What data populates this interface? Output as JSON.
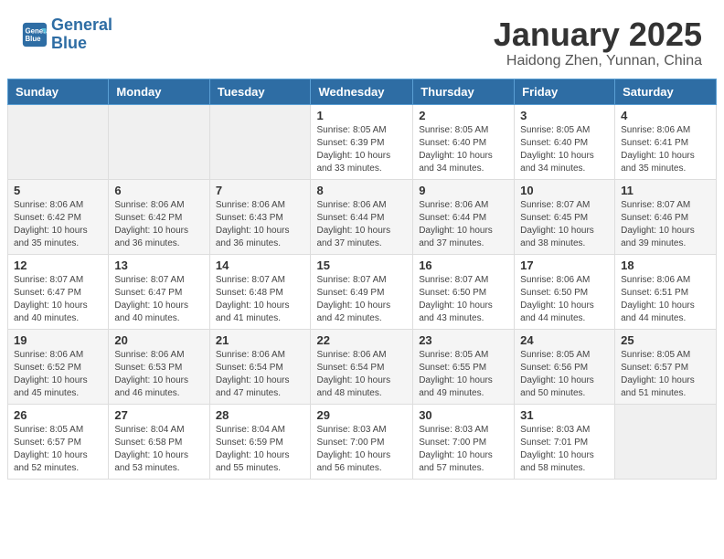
{
  "header": {
    "logo_line1": "General",
    "logo_line2": "Blue",
    "title": "January 2025",
    "subtitle": "Haidong Zhen, Yunnan, China"
  },
  "days_of_week": [
    "Sunday",
    "Monday",
    "Tuesday",
    "Wednesday",
    "Thursday",
    "Friday",
    "Saturday"
  ],
  "weeks": [
    [
      {
        "day": "",
        "info": ""
      },
      {
        "day": "",
        "info": ""
      },
      {
        "day": "",
        "info": ""
      },
      {
        "day": "1",
        "info": "Sunrise: 8:05 AM\nSunset: 6:39 PM\nDaylight: 10 hours\nand 33 minutes."
      },
      {
        "day": "2",
        "info": "Sunrise: 8:05 AM\nSunset: 6:40 PM\nDaylight: 10 hours\nand 34 minutes."
      },
      {
        "day": "3",
        "info": "Sunrise: 8:05 AM\nSunset: 6:40 PM\nDaylight: 10 hours\nand 34 minutes."
      },
      {
        "day": "4",
        "info": "Sunrise: 8:06 AM\nSunset: 6:41 PM\nDaylight: 10 hours\nand 35 minutes."
      }
    ],
    [
      {
        "day": "5",
        "info": "Sunrise: 8:06 AM\nSunset: 6:42 PM\nDaylight: 10 hours\nand 35 minutes."
      },
      {
        "day": "6",
        "info": "Sunrise: 8:06 AM\nSunset: 6:42 PM\nDaylight: 10 hours\nand 36 minutes."
      },
      {
        "day": "7",
        "info": "Sunrise: 8:06 AM\nSunset: 6:43 PM\nDaylight: 10 hours\nand 36 minutes."
      },
      {
        "day": "8",
        "info": "Sunrise: 8:06 AM\nSunset: 6:44 PM\nDaylight: 10 hours\nand 37 minutes."
      },
      {
        "day": "9",
        "info": "Sunrise: 8:06 AM\nSunset: 6:44 PM\nDaylight: 10 hours\nand 37 minutes."
      },
      {
        "day": "10",
        "info": "Sunrise: 8:07 AM\nSunset: 6:45 PM\nDaylight: 10 hours\nand 38 minutes."
      },
      {
        "day": "11",
        "info": "Sunrise: 8:07 AM\nSunset: 6:46 PM\nDaylight: 10 hours\nand 39 minutes."
      }
    ],
    [
      {
        "day": "12",
        "info": "Sunrise: 8:07 AM\nSunset: 6:47 PM\nDaylight: 10 hours\nand 40 minutes."
      },
      {
        "day": "13",
        "info": "Sunrise: 8:07 AM\nSunset: 6:47 PM\nDaylight: 10 hours\nand 40 minutes."
      },
      {
        "day": "14",
        "info": "Sunrise: 8:07 AM\nSunset: 6:48 PM\nDaylight: 10 hours\nand 41 minutes."
      },
      {
        "day": "15",
        "info": "Sunrise: 8:07 AM\nSunset: 6:49 PM\nDaylight: 10 hours\nand 42 minutes."
      },
      {
        "day": "16",
        "info": "Sunrise: 8:07 AM\nSunset: 6:50 PM\nDaylight: 10 hours\nand 43 minutes."
      },
      {
        "day": "17",
        "info": "Sunrise: 8:06 AM\nSunset: 6:50 PM\nDaylight: 10 hours\nand 44 minutes."
      },
      {
        "day": "18",
        "info": "Sunrise: 8:06 AM\nSunset: 6:51 PM\nDaylight: 10 hours\nand 44 minutes."
      }
    ],
    [
      {
        "day": "19",
        "info": "Sunrise: 8:06 AM\nSunset: 6:52 PM\nDaylight: 10 hours\nand 45 minutes."
      },
      {
        "day": "20",
        "info": "Sunrise: 8:06 AM\nSunset: 6:53 PM\nDaylight: 10 hours\nand 46 minutes."
      },
      {
        "day": "21",
        "info": "Sunrise: 8:06 AM\nSunset: 6:54 PM\nDaylight: 10 hours\nand 47 minutes."
      },
      {
        "day": "22",
        "info": "Sunrise: 8:06 AM\nSunset: 6:54 PM\nDaylight: 10 hours\nand 48 minutes."
      },
      {
        "day": "23",
        "info": "Sunrise: 8:05 AM\nSunset: 6:55 PM\nDaylight: 10 hours\nand 49 minutes."
      },
      {
        "day": "24",
        "info": "Sunrise: 8:05 AM\nSunset: 6:56 PM\nDaylight: 10 hours\nand 50 minutes."
      },
      {
        "day": "25",
        "info": "Sunrise: 8:05 AM\nSunset: 6:57 PM\nDaylight: 10 hours\nand 51 minutes."
      }
    ],
    [
      {
        "day": "26",
        "info": "Sunrise: 8:05 AM\nSunset: 6:57 PM\nDaylight: 10 hours\nand 52 minutes."
      },
      {
        "day": "27",
        "info": "Sunrise: 8:04 AM\nSunset: 6:58 PM\nDaylight: 10 hours\nand 53 minutes."
      },
      {
        "day": "28",
        "info": "Sunrise: 8:04 AM\nSunset: 6:59 PM\nDaylight: 10 hours\nand 55 minutes."
      },
      {
        "day": "29",
        "info": "Sunrise: 8:03 AM\nSunset: 7:00 PM\nDaylight: 10 hours\nand 56 minutes."
      },
      {
        "day": "30",
        "info": "Sunrise: 8:03 AM\nSunset: 7:00 PM\nDaylight: 10 hours\nand 57 minutes."
      },
      {
        "day": "31",
        "info": "Sunrise: 8:03 AM\nSunset: 7:01 PM\nDaylight: 10 hours\nand 58 minutes."
      },
      {
        "day": "",
        "info": ""
      }
    ]
  ]
}
